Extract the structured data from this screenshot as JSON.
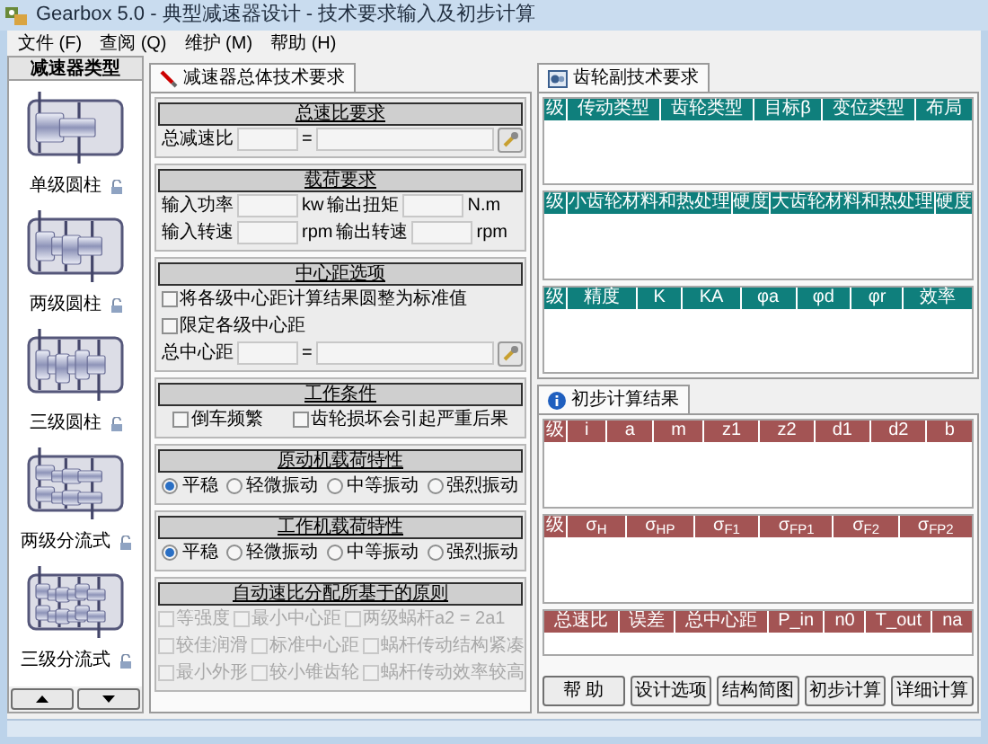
{
  "window": {
    "title": "Gearbox 5.0 - 典型减速器设计 - 技术要求输入及初步计算"
  },
  "menu": [
    "文件 (F)",
    "查阅 (Q)",
    "维护 (M)",
    "帮助 (H)"
  ],
  "sidebar": {
    "title": "减速器类型",
    "items": [
      {
        "label": "单级圆柱",
        "kind": "single"
      },
      {
        "label": "两级圆柱",
        "kind": "double"
      },
      {
        "label": "三级圆柱",
        "kind": "triple"
      },
      {
        "label": "两级分流式",
        "kind": "double_split"
      },
      {
        "label": "三级分流式",
        "kind": "triple_split"
      }
    ]
  },
  "requirements_tab": {
    "label": "减速器总体技术要求",
    "selected": true,
    "sections": [
      {
        "title": "总速比要求",
        "rows": [
          [
            {
              "kind": "label",
              "text": "总减速比"
            },
            {
              "kind": "input"
            },
            {
              "kind": "label",
              "text": "="
            },
            {
              "kind": "wide_input"
            },
            {
              "kind": "tool"
            }
          ]
        ]
      },
      {
        "title": "载荷要求",
        "rows": [
          [
            {
              "kind": "label",
              "text": "输入功率"
            },
            {
              "kind": "input"
            },
            {
              "kind": "unit",
              "text": "kw"
            },
            {
              "kind": "label",
              "text": "输出扭矩"
            },
            {
              "kind": "input"
            },
            {
              "kind": "unit",
              "text": "N.m"
            }
          ],
          [
            {
              "kind": "label",
              "text": "输入转速"
            },
            {
              "kind": "input"
            },
            {
              "kind": "unit",
              "text": "rpm"
            },
            {
              "kind": "label",
              "text": "输出转速"
            },
            {
              "kind": "input"
            },
            {
              "kind": "unit",
              "text": "rpm"
            }
          ]
        ]
      },
      {
        "title": "中心距选项",
        "rows": [
          [
            {
              "kind": "checkbox",
              "text": "将各级中心距计算结果圆整为标准值",
              "checked": false,
              "disabled": false
            }
          ],
          [
            {
              "kind": "checkbox",
              "text": "限定各级中心距",
              "checked": false,
              "disabled": false
            }
          ],
          [
            {
              "kind": "label",
              "text": "总中心距"
            },
            {
              "kind": "input"
            },
            {
              "kind": "label",
              "text": "="
            },
            {
              "kind": "wide_input"
            },
            {
              "kind": "tool"
            }
          ]
        ]
      },
      {
        "title": "工作条件",
        "rows": [
          [
            {
              "kind": "checkbox",
              "text": "倒车频繁",
              "checked": false,
              "disabled": false
            },
            {
              "kind": "checkbox",
              "text": "齿轮损坏会引起严重后果",
              "checked": false,
              "disabled": false
            }
          ]
        ]
      },
      {
        "title": "原动机载荷特性",
        "rows": [
          [
            {
              "kind": "radio",
              "text": "平稳",
              "selected": true
            },
            {
              "kind": "radio",
              "text": "轻微振动",
              "selected": false
            },
            {
              "kind": "radio",
              "text": "中等振动",
              "selected": false
            },
            {
              "kind": "radio",
              "text": "强烈振动",
              "selected": false
            }
          ]
        ]
      },
      {
        "title": "工作机载荷特性",
        "rows": [
          [
            {
              "kind": "radio",
              "text": "平稳",
              "selected": true
            },
            {
              "kind": "radio",
              "text": "轻微振动",
              "selected": false
            },
            {
              "kind": "radio",
              "text": "中等振动",
              "selected": false
            },
            {
              "kind": "radio",
              "text": "强烈振动",
              "selected": false
            }
          ]
        ]
      },
      {
        "title": "自动速比分配所基于的原则",
        "rows": [
          [
            {
              "kind": "checkbox",
              "text": "等强度",
              "checked": false,
              "disabled": true
            },
            {
              "kind": "checkbox",
              "text": "最小中心距",
              "checked": false,
              "disabled": true
            },
            {
              "kind": "checkbox",
              "text": "两级蜗杆a2 = 2a1",
              "checked": false,
              "disabled": true
            }
          ],
          [
            {
              "kind": "checkbox",
              "text": "较佳润滑",
              "checked": false,
              "disabled": true
            },
            {
              "kind": "checkbox",
              "text": "标准中心距",
              "checked": false,
              "disabled": true
            },
            {
              "kind": "checkbox",
              "text": "蜗杆传动结构紧凑",
              "checked": false,
              "disabled": true
            }
          ],
          [
            {
              "kind": "checkbox",
              "text": "最小外形",
              "checked": false,
              "disabled": true
            },
            {
              "kind": "checkbox",
              "text": "较小锥齿轮",
              "checked": false,
              "disabled": true
            },
            {
              "kind": "checkbox",
              "text": "蜗杆传动效率较高",
              "checked": false,
              "disabled": true
            }
          ]
        ]
      }
    ]
  },
  "gear_pair_tab": {
    "label": "齿轮副技术要求",
    "selected": true,
    "tables": [
      {
        "columns": [
          "级",
          "传动类型",
          "齿轮类型",
          "目标β",
          "变位类型",
          "布局"
        ]
      },
      {
        "columns": [
          "级",
          "小齿轮材料和热处理",
          "硬度",
          "大齿轮材料和热处理",
          "硬度"
        ]
      },
      {
        "columns": [
          "级",
          "精度",
          "K",
          "KA",
          "φa",
          "φd",
          "φr",
          "效率"
        ]
      }
    ]
  },
  "results_tab": {
    "label": "初步计算结果",
    "selected": true,
    "tables": [
      {
        "columns": [
          "级",
          "i",
          "a",
          "m",
          "z1",
          "z2",
          "d1",
          "d2",
          "b"
        ]
      },
      {
        "columns": [
          "级",
          "σ$_{H}$",
          "σ$_{HP}$",
          "σ$_{F1}$",
          "σ$_{FP1}$",
          "σ$_{F2}$",
          "σ$_{FP2}$"
        ]
      },
      {
        "columns": [
          "总速比",
          "误差",
          "总中心距",
          "P_in",
          "n0",
          "T_out",
          "na"
        ]
      }
    ]
  },
  "buttons": [
    "帮 助",
    "设计选项",
    "结构简图",
    "初步计算",
    "详细计算"
  ]
}
